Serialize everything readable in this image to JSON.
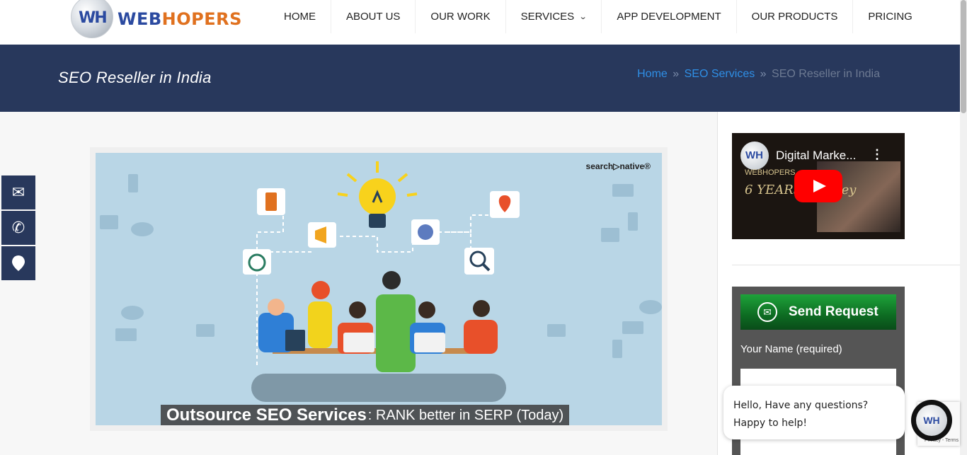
{
  "brand": {
    "logo_mark": "WH",
    "name_part1": "WEB",
    "name_part2": "HOPERS"
  },
  "nav": {
    "items": [
      {
        "label": "HOME"
      },
      {
        "label": "ABOUT US"
      },
      {
        "label": "OUR WORK"
      },
      {
        "label": "SERVICES",
        "has_dropdown": true
      },
      {
        "label": "APP DEVELOPMENT"
      },
      {
        "label": "OUR PRODUCTS"
      },
      {
        "label": "PRICING"
      }
    ],
    "dropdown_icon": "chevron-down-icon"
  },
  "title_band": {
    "title": "SEO Reseller in India",
    "breadcrumb": {
      "home": "Home",
      "separator": "»",
      "parent": "SEO Services",
      "current": "SEO Reseller in India"
    }
  },
  "hero": {
    "brand_mark": "search▷native®",
    "caption_bold": "Outsource SEO Services",
    "caption_rest": ": RANK better in SERP (Today)"
  },
  "contact_buttons": [
    {
      "icon": "envelope-icon",
      "glyph": "✉"
    },
    {
      "icon": "phone-icon",
      "glyph": "✆"
    },
    {
      "icon": "map-pin-icon",
      "glyph": "⬤"
    }
  ],
  "video": {
    "title": "Digital Marke...",
    "menu_glyph": "⋮",
    "logo_mark": "WH",
    "channel_text": "WEBHOPERS",
    "overlay_text": "6 YEARS Journey"
  },
  "form": {
    "button_label": "Send Request",
    "button_icon": "envelope-icon",
    "name_label": "Your Name (required)"
  },
  "chat": {
    "message": "Hello, Have any questions? Happy to help!",
    "avatar_mark": "WH"
  },
  "recaptcha": {
    "text": "Privacy - Terms"
  },
  "colors": {
    "navy": "#28385c",
    "link_blue": "#2f8fe6",
    "logo_blue": "#2b4aa0",
    "logo_orange": "#e0711f",
    "green_button": "#1ea33a",
    "hero_bg": "#b9d6e6"
  }
}
